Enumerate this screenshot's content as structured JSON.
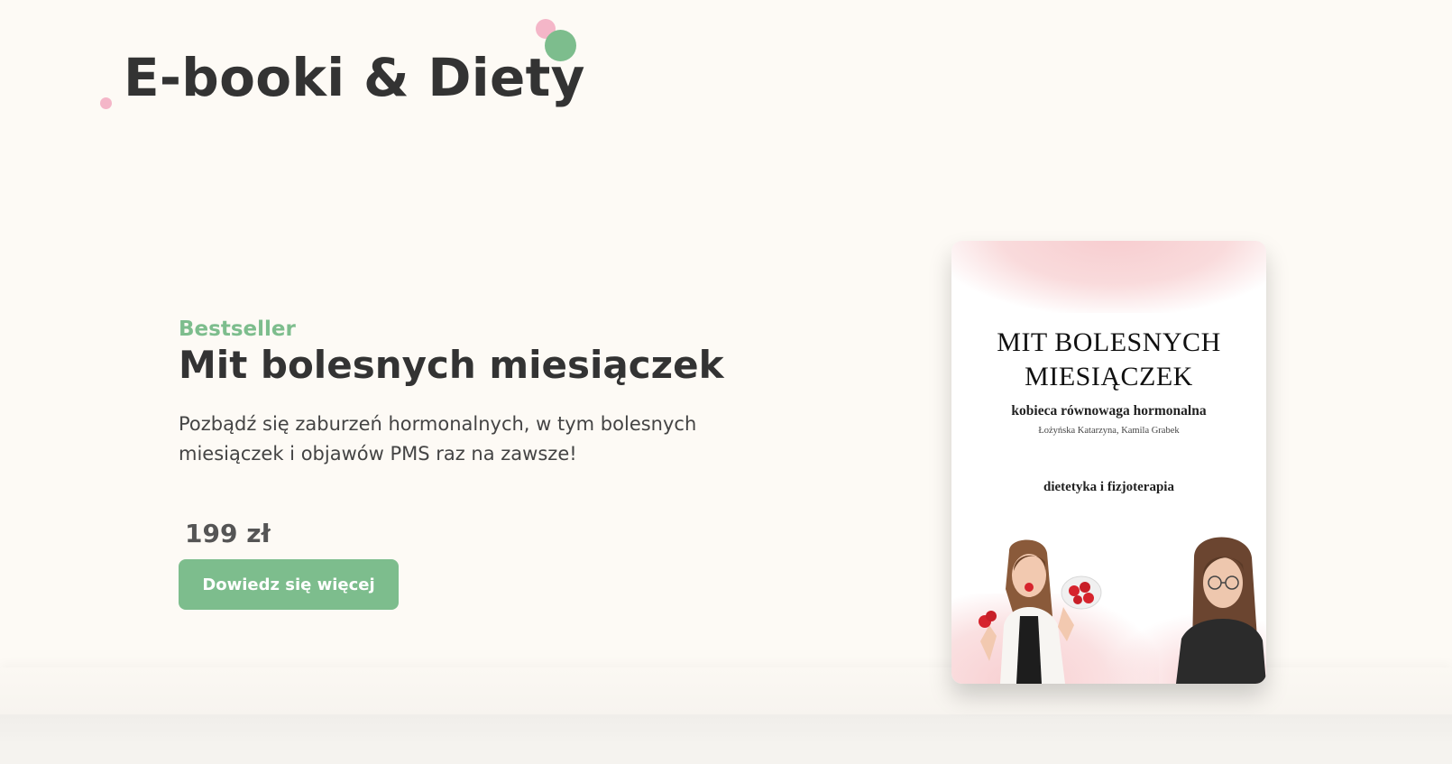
{
  "header": {
    "site_title": "E-booki & Diety"
  },
  "product": {
    "badge": "Bestseller",
    "title": "Mit bolesnych miesiączek",
    "description": "Pozbądź się zaburzeń hormonalnych, w tym bolesnych miesiączek i objawów PMS raz na zawsze!",
    "price": "199 zł",
    "cta_label": "Dowiedz się więcej"
  },
  "book_cover": {
    "title_line1": "MIT BOLESNYCH",
    "title_line2": "MIESIĄCZEK",
    "subtitle": "kobieca równowaga hormonalna",
    "authors": "Łożyńska Katarzyna, Kamila Grabek",
    "tagline": "dietetyka i fizjoterapia"
  },
  "colors": {
    "accent_green": "#7dbd8d",
    "accent_pink": "#f4b6c8",
    "background": "#fdfaf5",
    "text_dark": "#333333"
  }
}
